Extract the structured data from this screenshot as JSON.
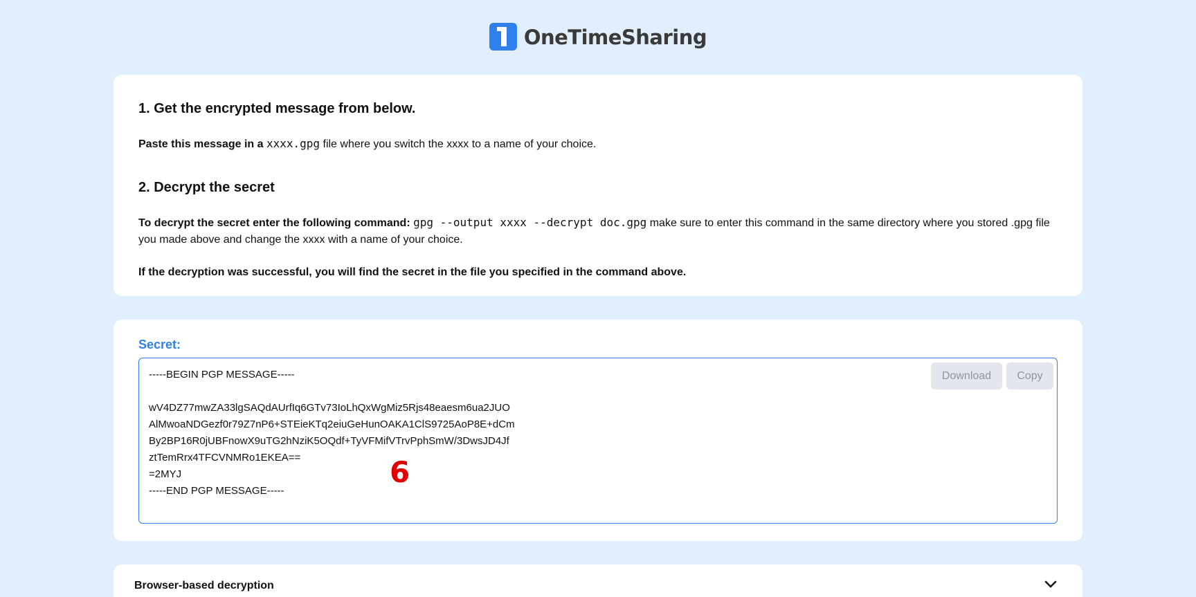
{
  "brand": {
    "name": "OneTimeSharing",
    "accent": "#2f80ed"
  },
  "step1": {
    "heading": "1. Get the encrypted message from below.",
    "lead": "Paste this message in a",
    "code": "xxxx.gpg",
    "rest": "file where you switch the xxxx to a name of your choice."
  },
  "step2": {
    "heading": "2. Decrypt the secret",
    "lead": "To decrypt the secret enter the following command:",
    "code": "gpg --output xxxx --decrypt doc.gpg",
    "rest": "make sure to enter this command in the same directory where you stored .gpg file you made above and change the xxxx with a name of your choice.",
    "success": "If the decryption was successful, you will find the secret in the file you specified in the command above."
  },
  "secret": {
    "label": "Secret:",
    "message": "-----BEGIN PGP MESSAGE-----\n\nwV4DZ77mwZA33lgSAQdAUrfIq6GTv73IoLhQxWgMiz5Rjs48eaesm6ua2JUO\nAlMwoaNDGezf0r79Z7nP6+STEieKTq2eiuGeHunOAKA1ClS9725AoP8E+dCm\nBy2BP16R0jUBFnowX9uTG2hNziK5OQdf+TyVFMifVTrvPphSmW/3DwsJD4Jf\nztTemRrx4TFCVNMRo1EKEA==\n=2MYJ\n-----END PGP MESSAGE-----",
    "download_label": "Download",
    "copy_label": "Copy",
    "overlay_number": "6"
  },
  "accordion": {
    "title": "Browser-based decryption",
    "icon": "chevron-down-icon"
  }
}
